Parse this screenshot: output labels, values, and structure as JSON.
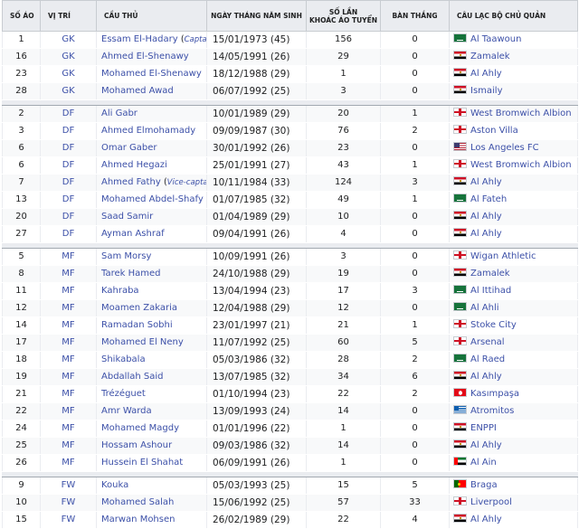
{
  "headers": {
    "number": "SỐ ÁO",
    "position": "VỊ TRÍ",
    "player": "CẦU THỦ",
    "dob": "NGÀY THÁNG NĂM SINH",
    "caps_line1": "SỐ LẦN",
    "caps_line2": "KHOÁC ÁO TUYỂN",
    "goals": "BÀN THẮNG",
    "club": "CÂU LẠC BỘ CHỦ QUẢN"
  },
  "groups": [
    [
      {
        "no": "1",
        "pos": "GK",
        "name": "Essam El-Hadary",
        "role": "Captain",
        "dob": "15/01/1973 (45)",
        "caps": "156",
        "goals": "0",
        "flag": "sa",
        "club": "Al Taawoun"
      },
      {
        "no": "16",
        "pos": "GK",
        "name": "Ahmed El-Shenawy",
        "dob": "14/05/1991 (26)",
        "caps": "29",
        "goals": "0",
        "flag": "eg",
        "club": "Zamalek"
      },
      {
        "no": "23",
        "pos": "GK",
        "name": "Mohamed El-Shenawy",
        "dob": "18/12/1988 (29)",
        "caps": "1",
        "goals": "0",
        "flag": "eg",
        "club": "Al Ahly"
      },
      {
        "no": "28",
        "pos": "GK",
        "name": "Mohamed Awad",
        "dob": "06/07/1992 (25)",
        "caps": "3",
        "goals": "0",
        "flag": "eg",
        "club": "Ismaily"
      }
    ],
    [
      {
        "no": "2",
        "pos": "DF",
        "name": "Ali Gabr",
        "dob": "10/01/1989 (29)",
        "caps": "20",
        "goals": "1",
        "flag": "en",
        "club": "West Bromwich Albion"
      },
      {
        "no": "3",
        "pos": "DF",
        "name": "Ahmed Elmohamady",
        "dob": "09/09/1987 (30)",
        "caps": "76",
        "goals": "2",
        "flag": "en",
        "club": "Aston Villa"
      },
      {
        "no": "6",
        "pos": "DF",
        "name": "Omar Gaber",
        "dob": "30/01/1992 (26)",
        "caps": "23",
        "goals": "0",
        "flag": "us",
        "club": "Los Angeles FC"
      },
      {
        "no": "6",
        "pos": "DF",
        "name": "Ahmed Hegazi",
        "dob": "25/01/1991 (27)",
        "caps": "43",
        "goals": "1",
        "flag": "en",
        "club": "West Bromwich Albion"
      },
      {
        "no": "7",
        "pos": "DF",
        "name": "Ahmed Fathy",
        "role": "Vice-captain",
        "dob": "10/11/1984 (33)",
        "caps": "124",
        "goals": "3",
        "flag": "eg",
        "club": "Al Ahly"
      },
      {
        "no": "13",
        "pos": "DF",
        "name": "Mohamed Abdel-Shafy",
        "dob": "01/07/1985 (32)",
        "caps": "49",
        "goals": "1",
        "flag": "sa",
        "club": "Al Fateh"
      },
      {
        "no": "20",
        "pos": "DF",
        "name": "Saad Samir",
        "dob": "01/04/1989 (29)",
        "caps": "10",
        "goals": "0",
        "flag": "eg",
        "club": "Al Ahly"
      },
      {
        "no": "27",
        "pos": "DF",
        "name": "Ayman Ashraf",
        "dob": "09/04/1991 (26)",
        "caps": "4",
        "goals": "0",
        "flag": "eg",
        "club": "Al Ahly"
      }
    ],
    [
      {
        "no": "5",
        "pos": "MF",
        "name": "Sam Morsy",
        "dob": "10/09/1991 (26)",
        "caps": "3",
        "goals": "0",
        "flag": "en",
        "club": "Wigan Athletic"
      },
      {
        "no": "8",
        "pos": "MF",
        "name": "Tarek Hamed",
        "dob": "24/10/1988 (29)",
        "caps": "19",
        "goals": "0",
        "flag": "eg",
        "club": "Zamalek"
      },
      {
        "no": "11",
        "pos": "MF",
        "name": "Kahraba",
        "dob": "13/04/1994 (23)",
        "caps": "17",
        "goals": "3",
        "flag": "sa",
        "club": "Al Ittihad"
      },
      {
        "no": "12",
        "pos": "MF",
        "name": "Moamen Zakaria",
        "dob": "12/04/1988 (29)",
        "caps": "12",
        "goals": "0",
        "flag": "sa",
        "club": "Al Ahli"
      },
      {
        "no": "14",
        "pos": "MF",
        "name": "Ramadan Sobhi",
        "dob": "23/01/1997 (21)",
        "caps": "21",
        "goals": "1",
        "flag": "en",
        "club": "Stoke City"
      },
      {
        "no": "17",
        "pos": "MF",
        "name": "Mohamed El Neny",
        "dob": "11/07/1992 (25)",
        "caps": "60",
        "goals": "5",
        "flag": "en",
        "club": "Arsenal"
      },
      {
        "no": "18",
        "pos": "MF",
        "name": "Shikabala",
        "dob": "05/03/1986 (32)",
        "caps": "28",
        "goals": "2",
        "flag": "sa",
        "club": "Al Raed"
      },
      {
        "no": "19",
        "pos": "MF",
        "name": "Abdallah Said",
        "dob": "13/07/1985 (32)",
        "caps": "34",
        "goals": "6",
        "flag": "eg",
        "club": "Al Ahly"
      },
      {
        "no": "21",
        "pos": "MF",
        "name": "Trézéguet",
        "dob": "01/10/1994 (23)",
        "caps": "22",
        "goals": "2",
        "flag": "tr",
        "club": "Kasımpaşa"
      },
      {
        "no": "22",
        "pos": "MF",
        "name": "Amr Warda",
        "dob": "13/09/1993 (24)",
        "caps": "14",
        "goals": "0",
        "flag": "gr",
        "club": "Atromitos"
      },
      {
        "no": "24",
        "pos": "MF",
        "name": "Mohamed Magdy",
        "dob": "01/01/1996 (22)",
        "caps": "1",
        "goals": "0",
        "flag": "eg",
        "club": "ENPPI"
      },
      {
        "no": "25",
        "pos": "MF",
        "name": "Hossam Ashour",
        "dob": "09/03/1986 (32)",
        "caps": "14",
        "goals": "0",
        "flag": "eg",
        "club": "Al Ahly"
      },
      {
        "no": "26",
        "pos": "MF",
        "name": "Hussein El Shahat",
        "dob": "06/09/1991 (26)",
        "caps": "1",
        "goals": "0",
        "flag": "ae",
        "club": "Al Ain"
      }
    ],
    [
      {
        "no": "9",
        "pos": "FW",
        "name": "Kouka",
        "dob": "05/03/1993 (25)",
        "caps": "15",
        "goals": "5",
        "flag": "pt",
        "club": "Braga"
      },
      {
        "no": "10",
        "pos": "FW",
        "name": "Mohamed Salah",
        "dob": "15/06/1992 (25)",
        "caps": "57",
        "goals": "33",
        "flag": "en",
        "club": "Liverpool"
      },
      {
        "no": "15",
        "pos": "FW",
        "name": "Marwan Mohsen",
        "dob": "26/02/1989 (29)",
        "caps": "22",
        "goals": "4",
        "flag": "eg",
        "club": "Al Ahly"
      }
    ]
  ],
  "colors": {
    "link": "#3c50a8",
    "header_bg": "#eaecf0",
    "row_alt": "#f8f9fa"
  }
}
